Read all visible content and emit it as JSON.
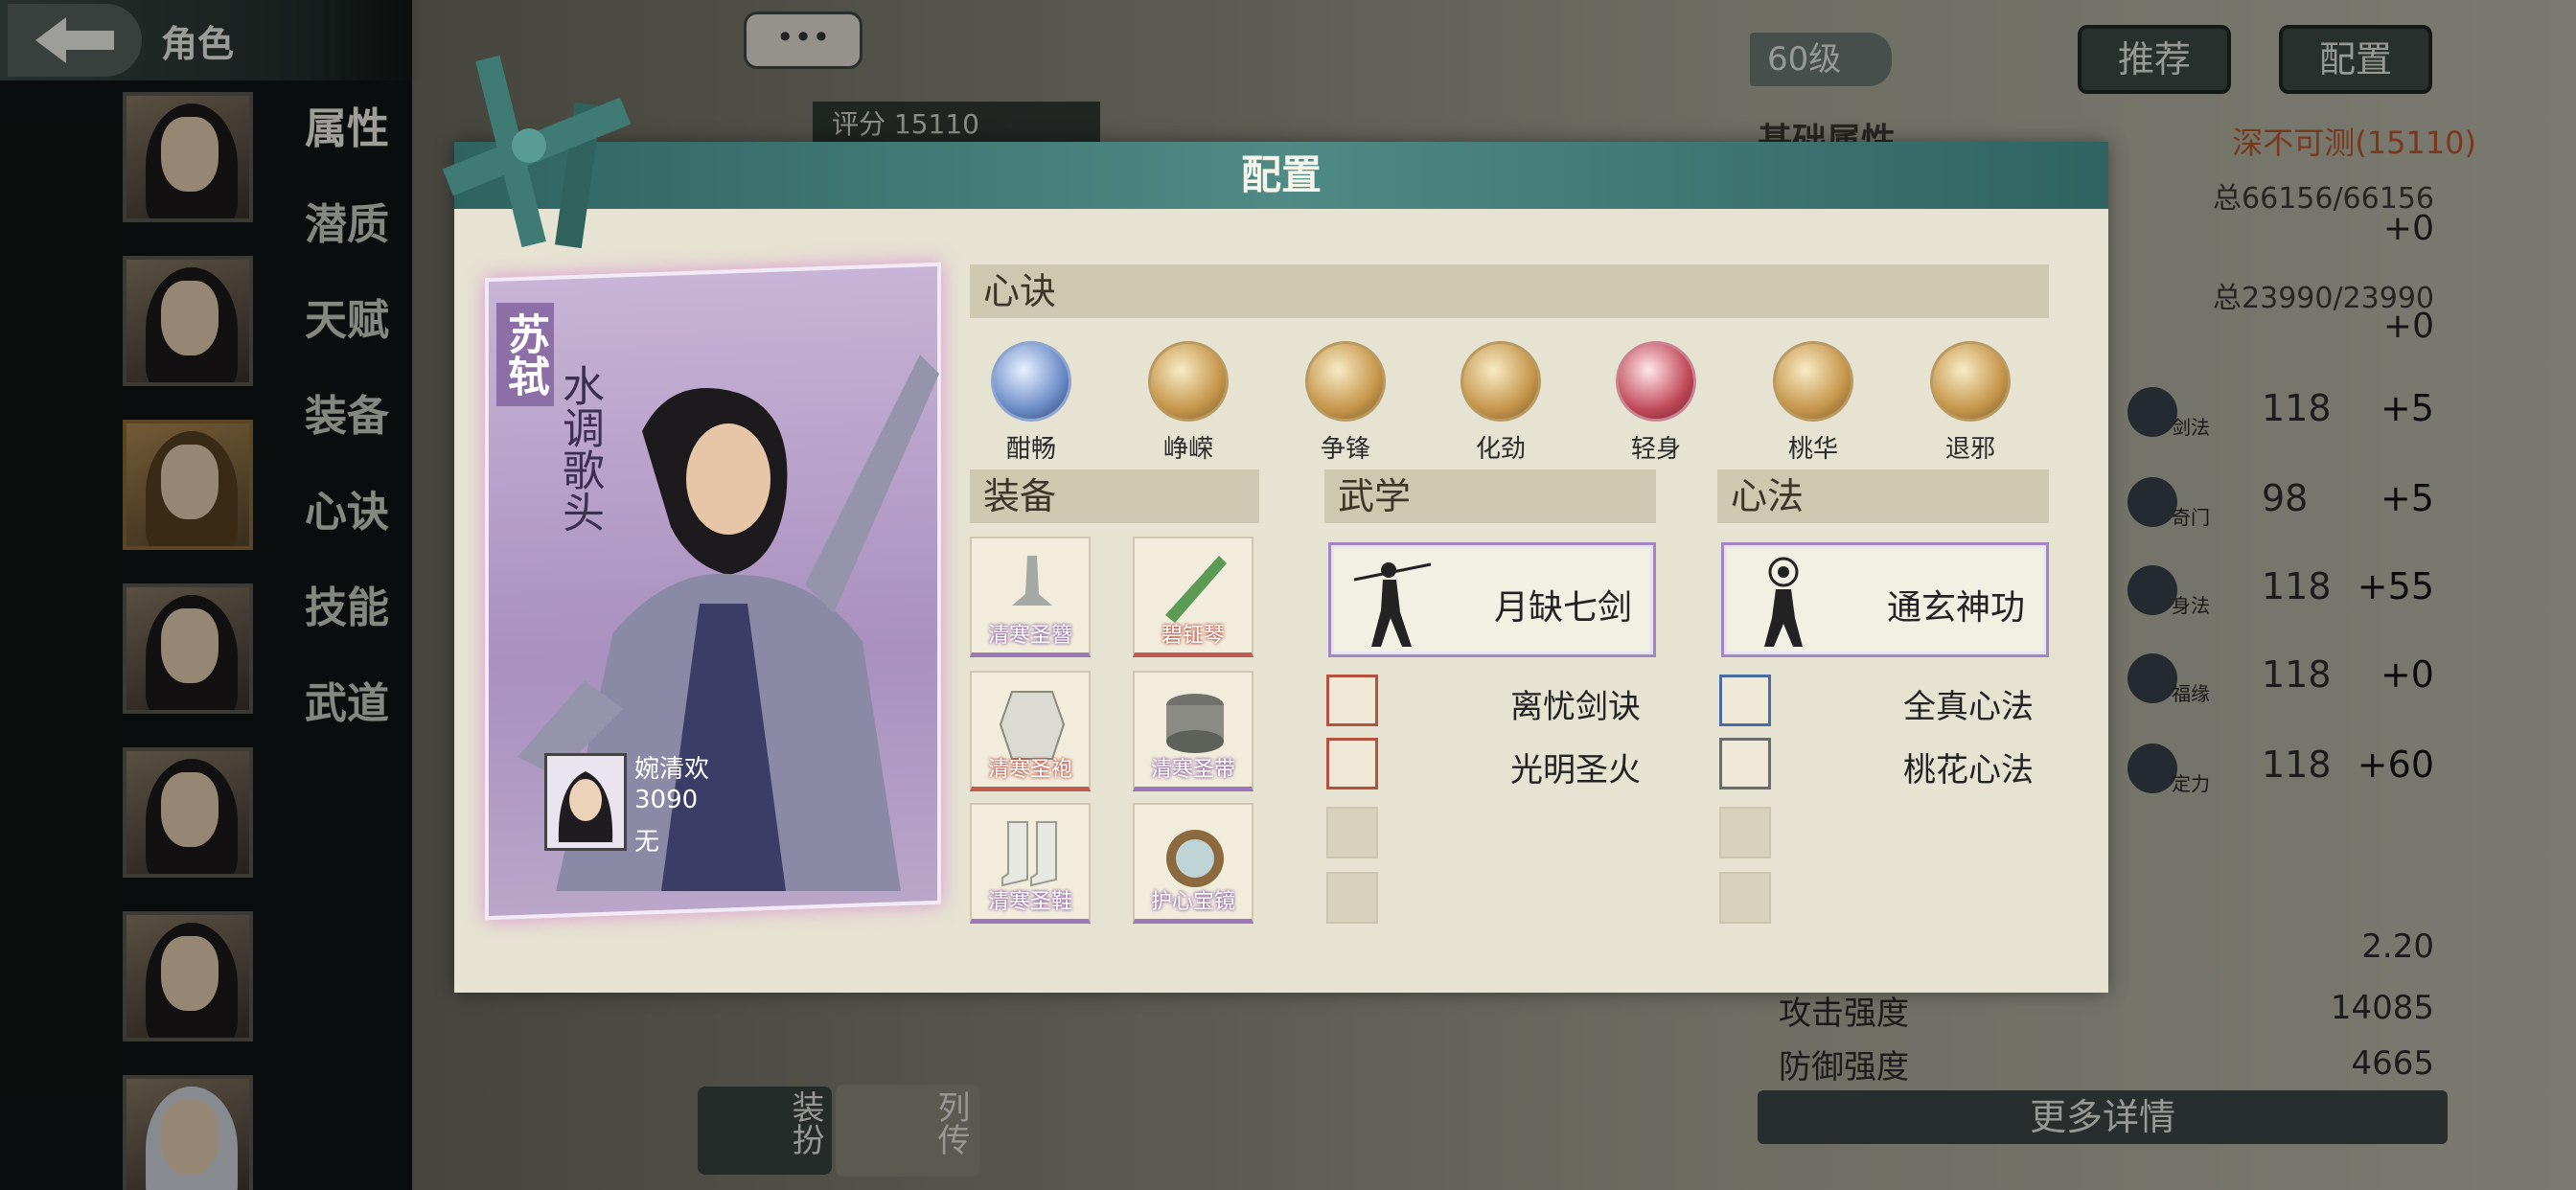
{
  "header": {
    "title": "角色",
    "chat": "•••",
    "score_label": "评分",
    "score": "15110"
  },
  "side_tabs": [
    "属性",
    "潜质",
    "天赋",
    "装备",
    "心诀",
    "技能",
    "武道"
  ],
  "right_panel": {
    "level": "60级",
    "recommend": "推荐",
    "config": "配置",
    "base_attr": "基础属性",
    "rank": "深不可测(15110)",
    "total1": "总66156/66156",
    "plus1": "+0",
    "total2": "总23990/23990",
    "plus2": "+0",
    "skills": [
      {
        "name": "剑法",
        "value": "118",
        "plus": "+5"
      },
      {
        "name": "奇门",
        "value": "98",
        "plus": "+5"
      },
      {
        "name": "身法",
        "value": "118",
        "plus": "+55"
      },
      {
        "name": "福缘",
        "value": "118",
        "plus": "+0"
      },
      {
        "name": "定力",
        "value": "118",
        "plus": "+60"
      }
    ],
    "stat_crit": "2.20",
    "attack_label": "攻击强度",
    "attack": "14085",
    "defense_label": "防御强度",
    "defense": "4665",
    "more": "更多详情"
  },
  "bottom_buttons": {
    "costume": "装扮",
    "bio": "列传"
  },
  "modal": {
    "title": "配置",
    "character": {
      "name": "苏轼",
      "title": "水调歌头"
    },
    "partner": {
      "name": "婉清欢",
      "value": "3090",
      "status": "无"
    },
    "sections": {
      "xinjue": "心诀",
      "equipment": "装备",
      "wuxue": "武学",
      "xinfa": "心法"
    },
    "talents": [
      "酣畅",
      "峥嵘",
      "争锋",
      "化劲",
      "轻身",
      "桃华",
      "退邪"
    ],
    "equipment": [
      "清寒圣簪",
      "碧钲琴",
      "清寒圣袍",
      "清寒圣带",
      "清寒圣鞋",
      "护心宝镜"
    ],
    "wuxue": {
      "main": "月缺七剑",
      "sub": [
        "离忧剑诀",
        "光明圣火"
      ]
    },
    "xinfa": {
      "main": "通玄神功",
      "sub": [
        "全真心法",
        "桃花心法"
      ]
    }
  }
}
